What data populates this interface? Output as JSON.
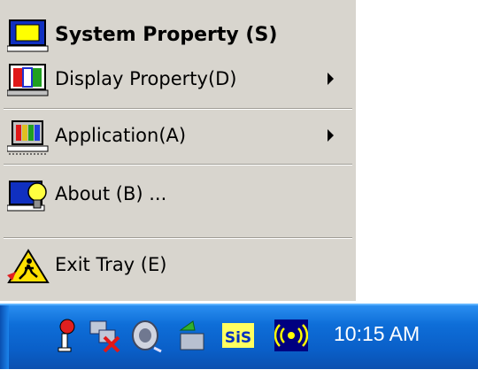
{
  "menu": {
    "items": [
      {
        "label": "System Property (S)",
        "icon": "system-property-icon"
      },
      {
        "label": "Display Property(D)",
        "icon": "display-property-icon",
        "submenu": true
      },
      {
        "label": "Application(A)",
        "icon": "application-icon",
        "submenu": true
      },
      {
        "label": "About (B) ...",
        "icon": "about-icon"
      },
      {
        "label": "Exit Tray (E)",
        "icon": "exit-tray-icon"
      }
    ]
  },
  "tray": {
    "icons": [
      "network-warning-icon",
      "network-disconnected-icon",
      "volume-icon",
      "safely-remove-hardware-icon",
      "sis-icon",
      "wireless-icon"
    ],
    "clock": "10:15 AM"
  },
  "colors": {
    "menu_bg": "#d8d5ce",
    "taskbar": "#0e6ed8"
  }
}
